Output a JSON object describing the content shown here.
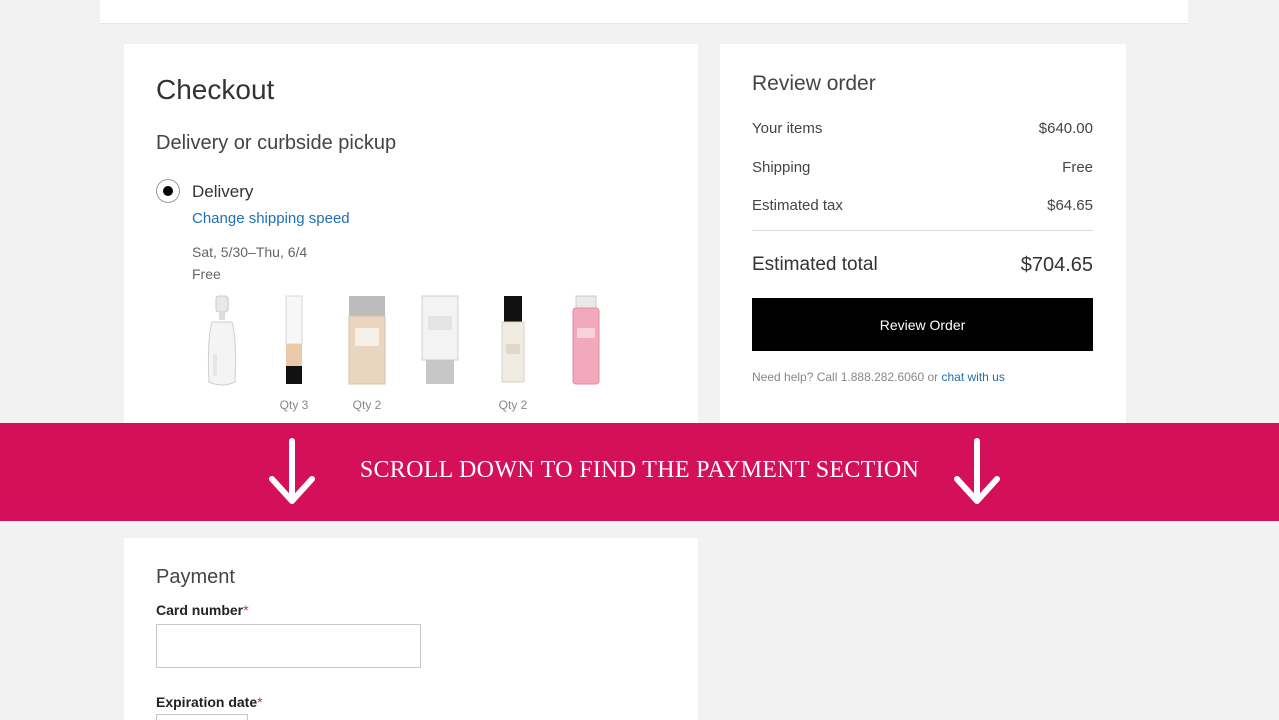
{
  "checkout": {
    "title": "Checkout",
    "subtitle": "Delivery or curbside pickup",
    "delivery_option": "Delivery",
    "change_speed_link": "Change shipping speed",
    "delivery_dates": "Sat, 5/30–Thu, 6/4",
    "shipping_cost": "Free",
    "products": [
      {
        "icon": "perfume-bottle-icon",
        "qty": ""
      },
      {
        "icon": "foundation-tube-icon",
        "qty": "Qty 3"
      },
      {
        "icon": "foundation-bottle-icon",
        "qty": "Qty 2"
      },
      {
        "icon": "moisturizer-tube-icon",
        "qty": ""
      },
      {
        "icon": "serum-bottle-icon",
        "qty": "Qty 2"
      },
      {
        "icon": "toner-bottle-icon",
        "qty": ""
      }
    ]
  },
  "review": {
    "title": "Review order",
    "items_label": "Your items",
    "items_value": "$640.00",
    "shipping_label": "Shipping",
    "shipping_value": "Free",
    "tax_label": "Estimated tax",
    "tax_value": "$64.65",
    "total_label": "Estimated total",
    "total_value": "$704.65",
    "button_label": "Review Order",
    "help_text": "Need help? Call 1.888.282.6060 or ",
    "help_link": "chat with us"
  },
  "banner": {
    "text": "SCROLL DOWN TO FIND THE PAYMENT SECTION",
    "color": "#d4105a"
  },
  "payment": {
    "title": "Payment",
    "card_number_label": "Card number",
    "expiration_label": "Expiration date",
    "required_marker": "*",
    "card_number_value": ""
  },
  "colors": {
    "accent": "#d4105a",
    "link": "#1f6fb4",
    "button": "#000000"
  }
}
